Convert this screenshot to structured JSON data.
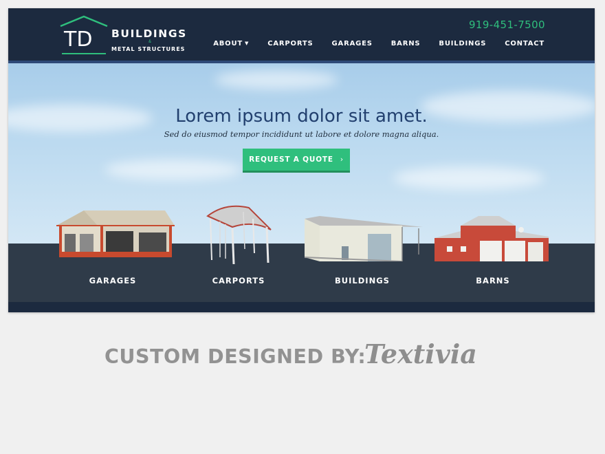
{
  "header": {
    "logo_initials": "TD",
    "logo_name": "BUILDINGS",
    "logo_amp": "&",
    "logo_sub": "METAL STRUCTURES",
    "phone": "919-451-7500",
    "nav": [
      "ABOUT",
      "CARPORTS",
      "GARAGES",
      "BARNS",
      "BUILDINGS",
      "CONTACT"
    ]
  },
  "hero": {
    "title": "Lorem ipsum dolor sit amet.",
    "subtitle": "Sed do eiusmod tempor incididunt ut labore et dolore magna aliqua.",
    "cta_label": "REQUEST A QUOTE",
    "cta_icon": "chevron-right-icon"
  },
  "categories": [
    "GARAGES",
    "CARPORTS",
    "BUILDINGS",
    "BARNS"
  ],
  "credit": {
    "label": "CUSTOM DESIGNED BY:",
    "brand": "Textivia"
  },
  "colors": {
    "navy": "#1c2a3f",
    "accent_green": "#2fbf7d",
    "title_blue": "#22406f",
    "band": "#2f3b49"
  }
}
